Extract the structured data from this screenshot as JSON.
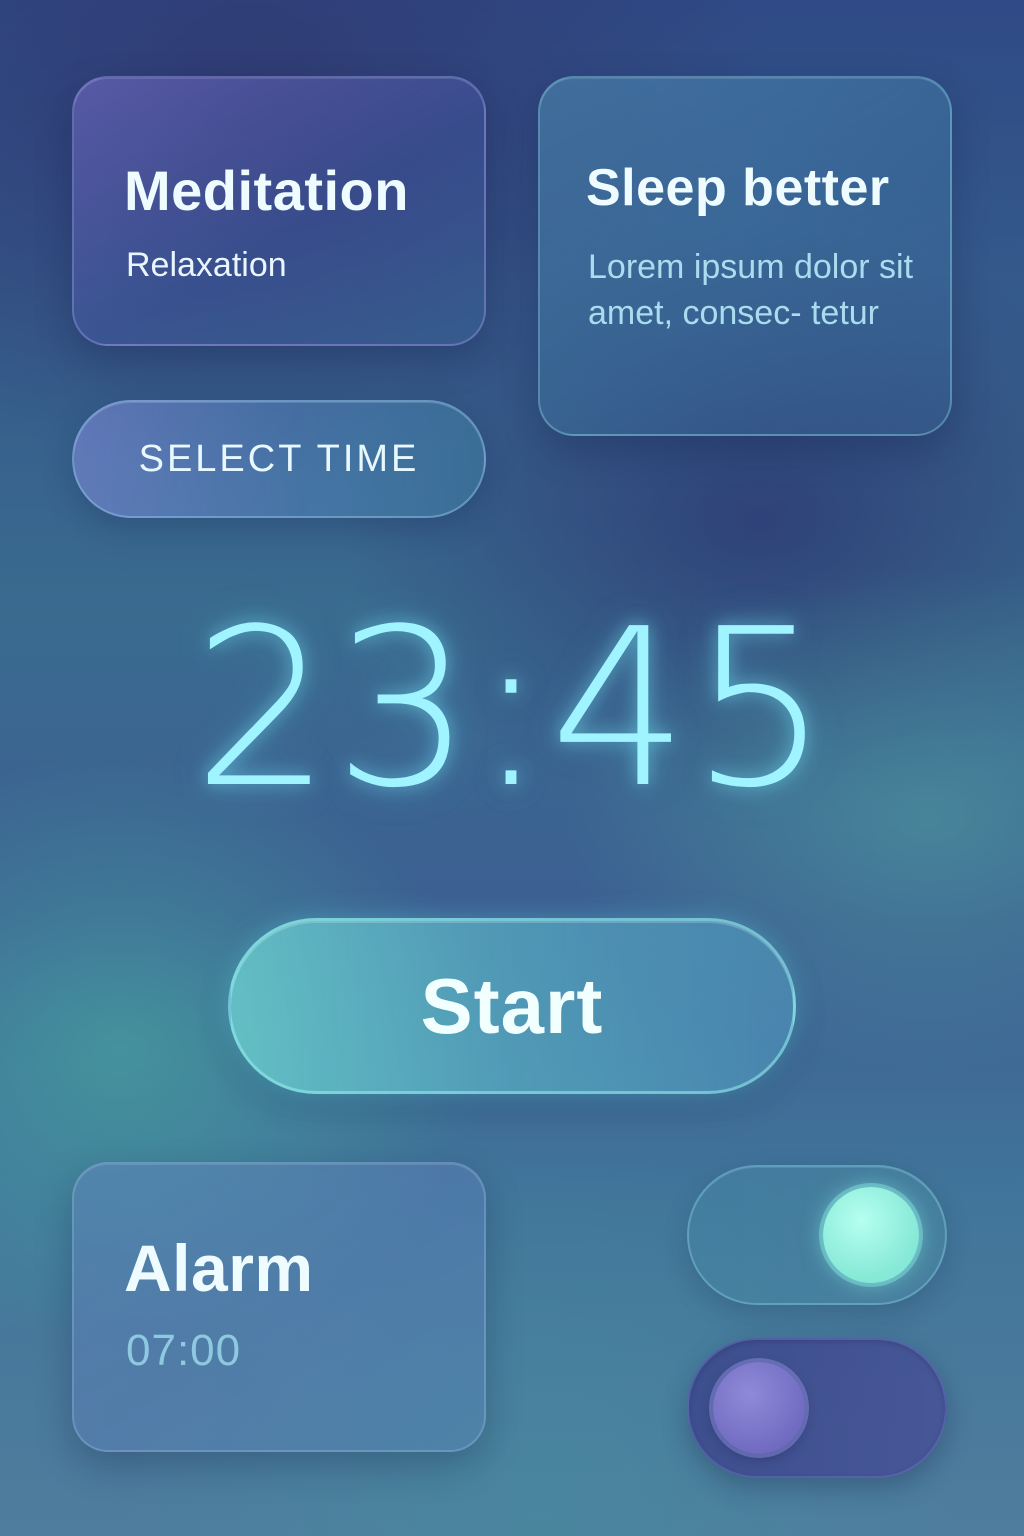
{
  "meditation_card": {
    "title": "Meditation",
    "subtitle": "Relaxation"
  },
  "sleep_card": {
    "title": "Sleep better",
    "body": "Lorem ipsum dolor sit amet, consec- tetur"
  },
  "select_time": {
    "label": "SELECT TIME"
  },
  "clock": {
    "time": "23:45"
  },
  "start": {
    "label": "Start"
  },
  "alarm_card": {
    "title": "Alarm",
    "time": "07:00"
  },
  "toggles": [
    {
      "state": "on",
      "accent": "#86e8d6"
    },
    {
      "state": "off",
      "accent": "#6f6ac0"
    }
  ],
  "colors": {
    "accent_cyan": "#9ff4ff",
    "mint": "#86e8d6",
    "indigo": "#3c4590"
  }
}
